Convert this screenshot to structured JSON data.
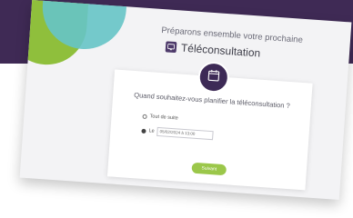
{
  "header": {
    "heading": "Préparons ensemble votre prochaine",
    "brand_name": "Téléconsultation"
  },
  "form": {
    "question": "Quand souhaitez-vous planifier la téléconsultation ?",
    "options": [
      {
        "label": "Tout de suite",
        "selected": false
      },
      {
        "label": "Le",
        "selected": true
      }
    ],
    "date_value": "05/02/2024 à 13:00",
    "submit_label": "Suivant"
  },
  "colors": {
    "band": "#3f2a55",
    "accent_green": "#8fbf3c",
    "accent_teal": "#66c4c7",
    "badge": "#3d2a56"
  },
  "icons": [
    "teleconsultation-logo-icon",
    "calendar-icon"
  ]
}
